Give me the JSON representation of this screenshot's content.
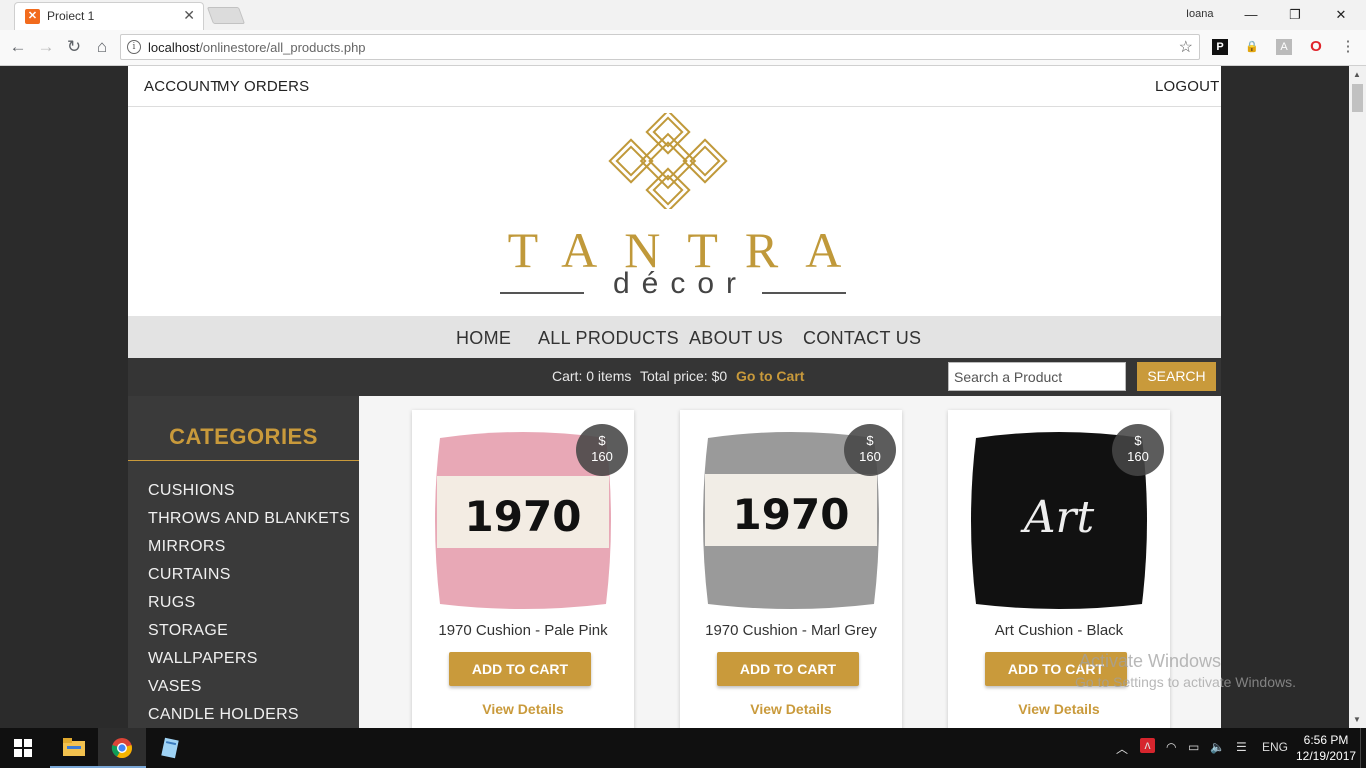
{
  "browser": {
    "tab_title": "Proiect 1",
    "tab_favicon": "xampp-icon",
    "user_name": "Ioana",
    "url_host": "localhost",
    "url_path": "/onlinestore/all_products.php"
  },
  "site": {
    "top_links": {
      "account": "ACCOUNT",
      "orders": "MY ORDERS",
      "logout": "LOGOUT"
    },
    "brand": {
      "name": "TANTRA",
      "sub": "décor",
      "color": "#c0993a"
    },
    "nav": [
      "HOME",
      "ALL PRODUCTS",
      "ABOUT US",
      "CONTACT US"
    ],
    "cart": {
      "items_text": "Cart: 0 items",
      "price_text": "Total price: $0",
      "go_link": "Go to Cart"
    },
    "search": {
      "placeholder": "Search a Product",
      "button": "SEARCH"
    },
    "categories": {
      "title": "CATEGORIES",
      "items": [
        "CUSHIONS",
        "THROWS AND BLANKETS",
        "MIRRORS",
        "CURTAINS",
        "RUGS",
        "STORAGE",
        "WALLPAPERS",
        "VASES",
        "CANDLE HOLDERS"
      ]
    },
    "products": [
      {
        "name": "1970 Cushion - Pale Pink",
        "currency": "$",
        "price": "160",
        "image_text": "1970",
        "color": "#e8a8b6",
        "add": "ADD TO CART",
        "details": "View Details"
      },
      {
        "name": "1970 Cushion - Marl Grey",
        "currency": "$",
        "price": "160",
        "image_text": "1970",
        "color": "#9a9a9a",
        "add": "ADD TO CART",
        "details": "View Details"
      },
      {
        "name": "Art Cushion - Black",
        "currency": "$",
        "price": "160",
        "image_text": "Art",
        "color": "#111111",
        "add": "ADD TO CART",
        "details": "View Details"
      }
    ],
    "accent_color": "#c99a3b"
  },
  "watermark": {
    "line1": "Activate Windows",
    "line2": "Go to Settings to activate Windows."
  },
  "taskbar": {
    "apps": [
      "file-explorer-icon",
      "chrome-icon",
      "notepad-icon"
    ],
    "language": "ENG",
    "time": "6:56 PM",
    "date": "12/19/2017"
  }
}
